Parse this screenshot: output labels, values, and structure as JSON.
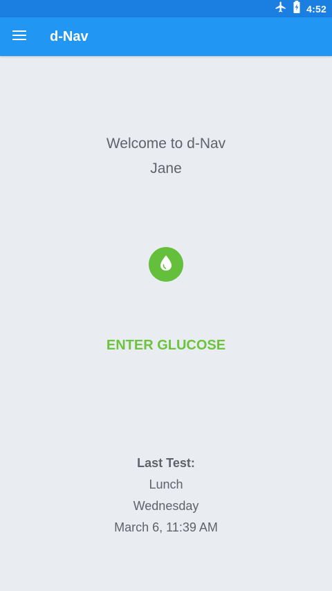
{
  "status_bar": {
    "icons": [
      "airplane-icon",
      "battery-charging-icon"
    ],
    "time": "4:52"
  },
  "app_bar": {
    "menu_icon": "hamburger-menu-icon",
    "title": "d-Nav"
  },
  "welcome": {
    "line1": "Welcome to d-Nav",
    "name": "Jane"
  },
  "glucose": {
    "icon": "drop-icon",
    "button_label": "ENTER GLUCOSE"
  },
  "last_test": {
    "heading": "Last Test:",
    "meal": "Lunch",
    "day": "Wednesday",
    "datetime": "March 6, 11:39 AM"
  },
  "colors": {
    "status_bar": "#1a7fe0",
    "app_bar": "#2196f3",
    "accent_green": "#64bf3c",
    "background": "#e9edf2",
    "text_gray": "#5f6368"
  }
}
